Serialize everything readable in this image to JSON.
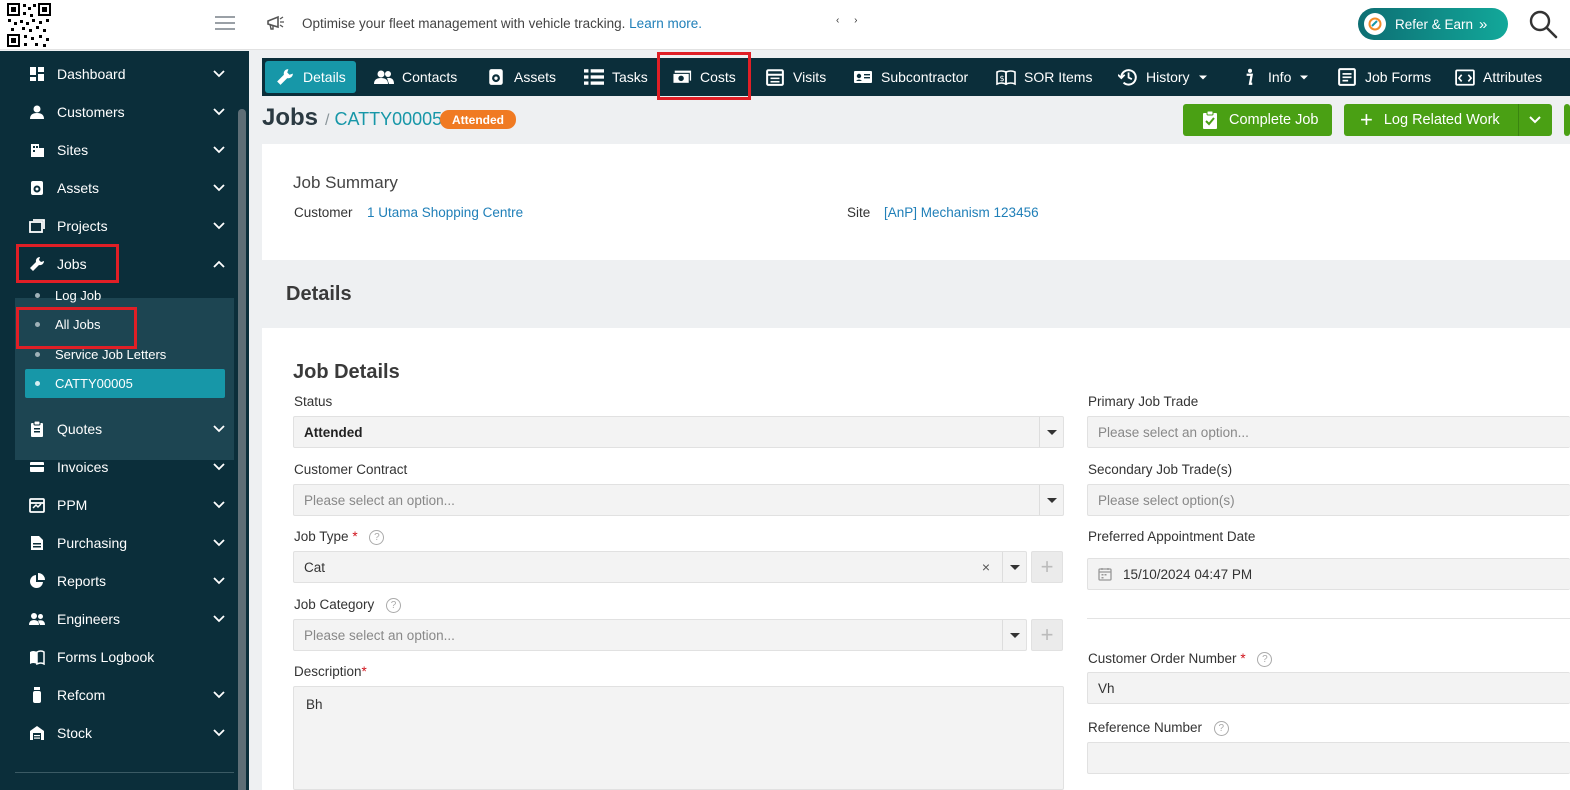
{
  "topbar": {
    "announcement": "Optimise your fleet management with vehicle tracking.",
    "learn_more": "Learn more.",
    "refer_button": "Refer & Earn",
    "refer_arrow": "»",
    "pager_prev": "‹",
    "pager_next": "›"
  },
  "sidebar": {
    "items": [
      {
        "label": "Dashboard",
        "icon": "dashboard-icon"
      },
      {
        "label": "Customers",
        "icon": "user-icon"
      },
      {
        "label": "Sites",
        "icon": "building-icon"
      },
      {
        "label": "Assets",
        "icon": "asset-icon"
      },
      {
        "label": "Projects",
        "icon": "projects-icon"
      },
      {
        "label": "Jobs",
        "icon": "wrench-icon"
      },
      {
        "label": "Quotes",
        "icon": "clipboard-icon"
      },
      {
        "label": "Invoices",
        "icon": "invoice-icon"
      },
      {
        "label": "PPM",
        "icon": "calendar-icon"
      },
      {
        "label": "Purchasing",
        "icon": "document-icon"
      },
      {
        "label": "Reports",
        "icon": "pie-chart-icon"
      },
      {
        "label": "Engineers",
        "icon": "users-icon"
      },
      {
        "label": "Forms Logbook",
        "icon": "book-icon"
      },
      {
        "label": "Refcom",
        "icon": "cylinder-icon"
      },
      {
        "label": "Stock",
        "icon": "warehouse-icon"
      }
    ],
    "jobs_sub": [
      "Log Job",
      "All Jobs",
      "Service Job Letters",
      "CATTY00005"
    ]
  },
  "tabs": [
    "Details",
    "Contacts",
    "Assets",
    "Tasks",
    "Costs",
    "Visits",
    "Subcontractor",
    "SOR Items",
    "History",
    "Info",
    "Job Forms",
    "Attributes"
  ],
  "header": {
    "title": "Jobs",
    "separator": "/",
    "job_id": "CATTY00005",
    "status_badge": "Attended",
    "complete_button": "Complete Job",
    "log_related_button": "Log Related Work"
  },
  "summary": {
    "title": "Job Summary",
    "customer_label": "Customer",
    "customer_value": "1 Utama Shopping Centre",
    "site_label": "Site",
    "site_value": "[AnP] Mechanism 123456"
  },
  "details_heading": "Details",
  "job_details": {
    "title": "Job Details",
    "status_label": "Status",
    "status_value": "Attended",
    "contract_label": "Customer Contract",
    "contract_placeholder": "Please select an option...",
    "job_type_label": "Job Type",
    "job_type_value": "Cat",
    "category_label": "Job Category",
    "category_placeholder": "Please select an option...",
    "description_label": "Description",
    "description_value": "Bh",
    "primary_trade_label": "Primary Job Trade",
    "primary_trade_placeholder": "Please select an option...",
    "secondary_trade_label": "Secondary Job Trade(s)",
    "secondary_trade_placeholder": "Please select option(s)",
    "appointment_label": "Preferred Appointment Date",
    "appointment_value": "15/10/2024 04:47 PM",
    "order_number_label": "Customer Order Number",
    "order_number_value": "Vh",
    "reference_label": "Reference Number",
    "reference_value": "",
    "required_mark": "*",
    "help_mark": "?",
    "clear_mark": "×",
    "add_mark": "+"
  }
}
